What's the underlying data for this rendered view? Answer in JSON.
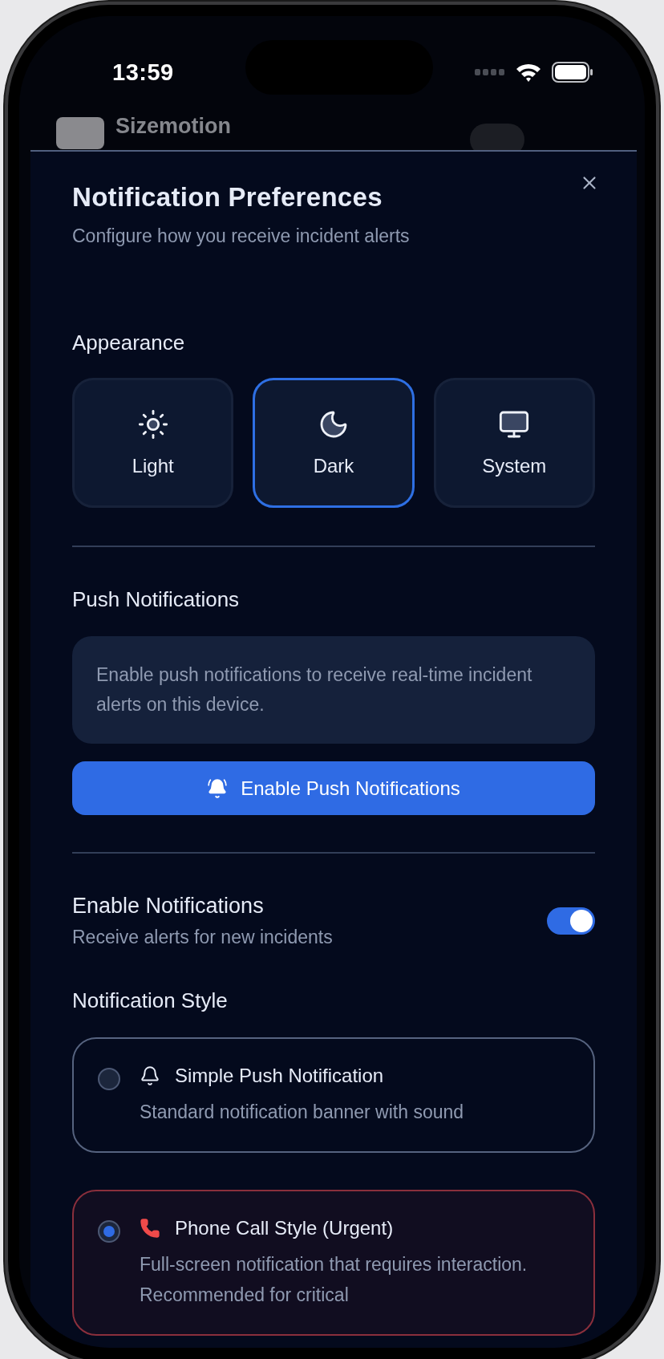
{
  "status_bar": {
    "time": "13:59"
  },
  "background_app": {
    "title": "Sizemotion"
  },
  "sheet": {
    "title": "Notification Preferences",
    "subtitle": "Configure how you receive incident alerts"
  },
  "appearance": {
    "heading": "Appearance",
    "options": [
      {
        "kind": "sun",
        "label": "Light",
        "selected": false
      },
      {
        "kind": "moon",
        "label": "Dark",
        "selected": true
      },
      {
        "kind": "monitor",
        "label": "System",
        "selected": false
      }
    ]
  },
  "push": {
    "heading": "Push Notifications",
    "info": "Enable push notifications to receive real-time incident alerts on this device.",
    "button": "Enable Push Notifications"
  },
  "enable": {
    "title": "Enable Notifications",
    "subtitle": "Receive alerts for new incidents",
    "on": true
  },
  "style": {
    "heading": "Notification Style",
    "options": [
      {
        "kind": "bell",
        "title": "Simple Push Notification",
        "description": "Standard notification banner with sound",
        "selected": false,
        "urgent": false
      },
      {
        "kind": "phone",
        "title": "Phone Call Style (Urgent)",
        "description": "Full-screen notification that requires interaction. Recommended for critical",
        "selected": true,
        "urgent": true
      }
    ]
  }
}
